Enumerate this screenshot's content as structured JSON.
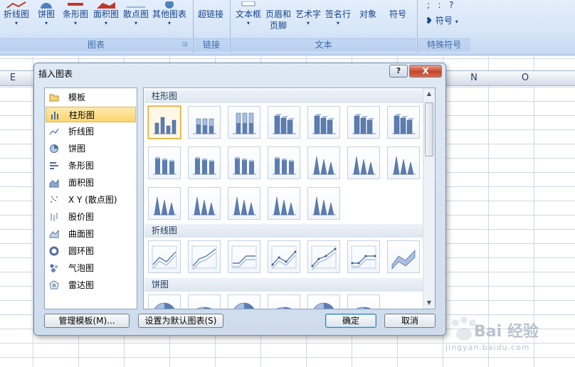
{
  "ribbon": {
    "buttons": [
      {
        "label": "折线图",
        "has_arrow": true
      },
      {
        "label": "饼图",
        "has_arrow": true
      },
      {
        "label": "条形图",
        "has_arrow": true
      },
      {
        "label": "面积图",
        "has_arrow": true
      },
      {
        "label": "散点图",
        "has_arrow": true
      },
      {
        "label": "其他图表",
        "has_arrow": true
      },
      {
        "label": "超链接",
        "has_arrow": false
      },
      {
        "label": "文本框",
        "has_arrow": true
      },
      {
        "label": "页眉和",
        "label2": "页脚",
        "has_arrow": false
      },
      {
        "label": "艺术字",
        "has_arrow": true
      },
      {
        "label": "签名行",
        "has_arrow": true
      },
      {
        "label": "对象",
        "has_arrow": false
      },
      {
        "label": "符号",
        "has_arrow": false
      }
    ],
    "special_symbols_btn": "符号",
    "special_symbols_glyphs": ";   :   ?",
    "groups": {
      "chart": "图表",
      "links": "链接",
      "text": "文本",
      "special": "特殊符号"
    }
  },
  "sheet": {
    "col_e": "E",
    "col_n": "N",
    "col_o": "O"
  },
  "dialog": {
    "title": "插入图表",
    "help": "?",
    "close": "X",
    "categories": [
      {
        "label": "模板",
        "icon": "folder-icon",
        "selected": false
      },
      {
        "label": "柱形图",
        "icon": "column-chart-icon",
        "selected": true
      },
      {
        "label": "折线图",
        "icon": "line-chart-icon",
        "selected": false
      },
      {
        "label": "饼图",
        "icon": "pie-chart-icon",
        "selected": false
      },
      {
        "label": "条形图",
        "icon": "bar-chart-icon",
        "selected": false
      },
      {
        "label": "面积图",
        "icon": "area-chart-icon",
        "selected": false
      },
      {
        "label": "X Y (散点图)",
        "icon": "scatter-chart-icon",
        "selected": false
      },
      {
        "label": "股价图",
        "icon": "stock-chart-icon",
        "selected": false
      },
      {
        "label": "曲面图",
        "icon": "surface-chart-icon",
        "selected": false
      },
      {
        "label": "圆环图",
        "icon": "doughnut-chart-icon",
        "selected": false
      },
      {
        "label": "气泡图",
        "icon": "bubble-chart-icon",
        "selected": false
      },
      {
        "label": "雷达图",
        "icon": "radar-chart-icon",
        "selected": false
      }
    ],
    "sections": [
      {
        "title": "柱形图"
      },
      {
        "title": "折线图"
      },
      {
        "title": "饼图"
      }
    ],
    "buttons": {
      "manage": "管理模板(M)...",
      "set_default": "设置为默认图表(S)",
      "ok": "确定",
      "cancel": "取消"
    }
  },
  "watermark": {
    "text": "Bai 经验",
    "url": "jingyan.baidu.com"
  }
}
